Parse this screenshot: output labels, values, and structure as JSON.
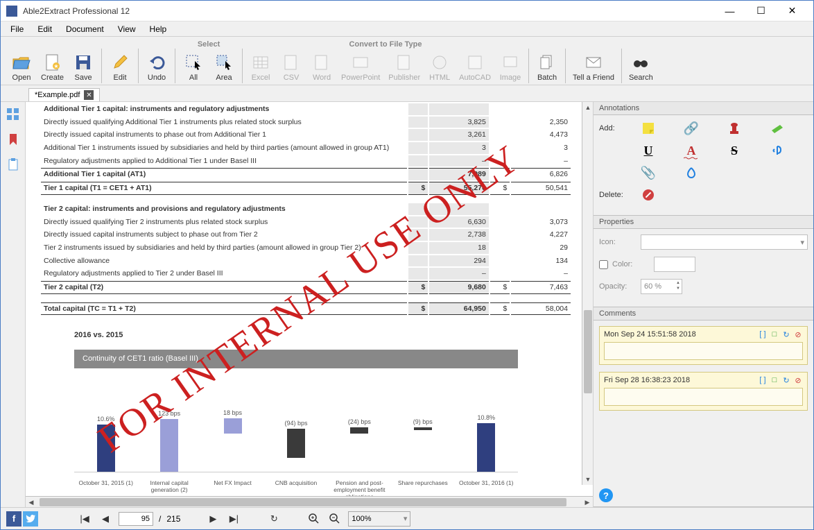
{
  "app": {
    "title": "Able2Extract Professional 12"
  },
  "menu": {
    "items": [
      "File",
      "Edit",
      "Document",
      "View",
      "Help"
    ]
  },
  "toolbar": {
    "sections": {
      "select": "Select",
      "convert": "Convert to File Type"
    },
    "buttons": {
      "open": "Open",
      "create": "Create",
      "save": "Save",
      "edit": "Edit",
      "undo": "Undo",
      "all": "All",
      "area": "Area",
      "excel": "Excel",
      "csv": "CSV",
      "word": "Word",
      "powerpoint": "PowerPoint",
      "publisher": "Publisher",
      "html": "HTML",
      "autocad": "AutoCAD",
      "image": "Image",
      "batch": "Batch",
      "tell": "Tell a Friend",
      "search": "Search"
    }
  },
  "tab": {
    "name": "*Example.pdf"
  },
  "annotations": {
    "header": "Annotations",
    "add_label": "Add:",
    "delete_label": "Delete:"
  },
  "properties": {
    "header": "Properties",
    "icon_label": "Icon:",
    "color_label": "Color:",
    "opacity_label": "Opacity:",
    "opacity_value": "60 %"
  },
  "comments": {
    "header": "Comments",
    "items": [
      {
        "date": "Mon Sep 24 15:51:58 2018"
      },
      {
        "date": "Fri Sep 28 16:38:23 2018"
      }
    ]
  },
  "pager": {
    "current": "95",
    "total": "215",
    "sep": "/",
    "zoom": "100%"
  },
  "doc": {
    "watermark": "FOR INTERNAL USE ONLY",
    "rows": [
      {
        "desc": "Additional Tier 1 capital: instruments and regulatory adjustments",
        "v1": "",
        "v2": "",
        "bold": true
      },
      {
        "desc": "Directly issued qualifying Additional Tier 1 instruments plus related stock surplus",
        "v1": "3,825",
        "v2": "2,350"
      },
      {
        "desc": "Directly issued capital instruments to phase out from Additional Tier 1",
        "v1": "3,261",
        "v2": "4,473"
      },
      {
        "desc": "Additional Tier 1 instruments issued by subsidiaries and held by third parties (amount allowed in group AT1)",
        "v1": "3",
        "v2": "3"
      },
      {
        "desc": "Regulatory adjustments applied to Additional Tier 1 under Basel III",
        "v1": "–",
        "v2": "–"
      },
      {
        "desc": "Additional Tier 1 capital (AT1)",
        "v1": "7,089",
        "v2": "6,826",
        "bold": true,
        "bt": true
      },
      {
        "desc": "Tier 1 capital (T1 = CET1 + AT1)",
        "c1": "$",
        "v1": "55,270",
        "c2": "$",
        "v2": "50,541",
        "bold": true,
        "bt": true,
        "bb": true
      },
      {
        "desc": "Tier 2 capital: instruments and provisions and regulatory adjustments",
        "bold": true,
        "spacer": true
      },
      {
        "desc": "Directly issued qualifying Tier 2 instruments plus related stock surplus",
        "v1": "6,630",
        "v2": "3,073"
      },
      {
        "desc": "Directly issued capital instruments subject to phase out from Tier 2",
        "v1": "2,738",
        "v2": "4,227"
      },
      {
        "desc": "Tier 2 instruments issued by subsidiaries and held by third parties (amount allowed in group Tier 2)",
        "v1": "18",
        "v2": "29"
      },
      {
        "desc": "Collective allowance",
        "v1": "294",
        "v2": "134"
      },
      {
        "desc": "Regulatory adjustments applied to Tier 2 under Basel III",
        "v1": "–",
        "v2": "–"
      },
      {
        "desc": "Tier 2 capital (T2)",
        "c1": "$",
        "v1": "9,680",
        "c2": "$",
        "v2": "7,463",
        "bold": true,
        "bt": true,
        "bb": true
      },
      {
        "desc": "Total capital (TC = T1 + T2)",
        "c1": "$",
        "v1": "64,950",
        "c2": "$",
        "v2": "58,004",
        "bold": true,
        "bt": true,
        "bb": true,
        "spacer": true
      }
    ],
    "vs_title": "2016 vs. 2015",
    "chart_title": "Continuity of CET1 ratio (Basel III)"
  },
  "chart_data": {
    "type": "bar",
    "title": "Continuity of CET1 ratio (Basel III)",
    "categories": [
      "October 31, 2015 (1)",
      "Internal capital generation (2)",
      "Net FX Impact",
      "CNB acquisition",
      "Pension and post-employment benefit obligations",
      "Share repurchases",
      "October 31, 2016 (1)"
    ],
    "labels": [
      "10.6%",
      "123 bps",
      "18 bps",
      "(94) bps",
      "(24) bps",
      "(9) bps",
      "10.8%"
    ],
    "values_pct": [
      10.6,
      1.23,
      0.18,
      -0.94,
      -0.24,
      -0.09,
      10.8
    ],
    "colors": [
      "#2f3f7f",
      "#9a9fd8",
      "#9a9fd8",
      "#3a3a3a",
      "#3a3a3a",
      "#3a3a3a",
      "#2f3f7f"
    ],
    "heights": [
      68,
      76,
      22,
      42,
      9,
      4,
      70
    ],
    "offsets": [
      0,
      0,
      55,
      20,
      55,
      60,
      0
    ]
  }
}
